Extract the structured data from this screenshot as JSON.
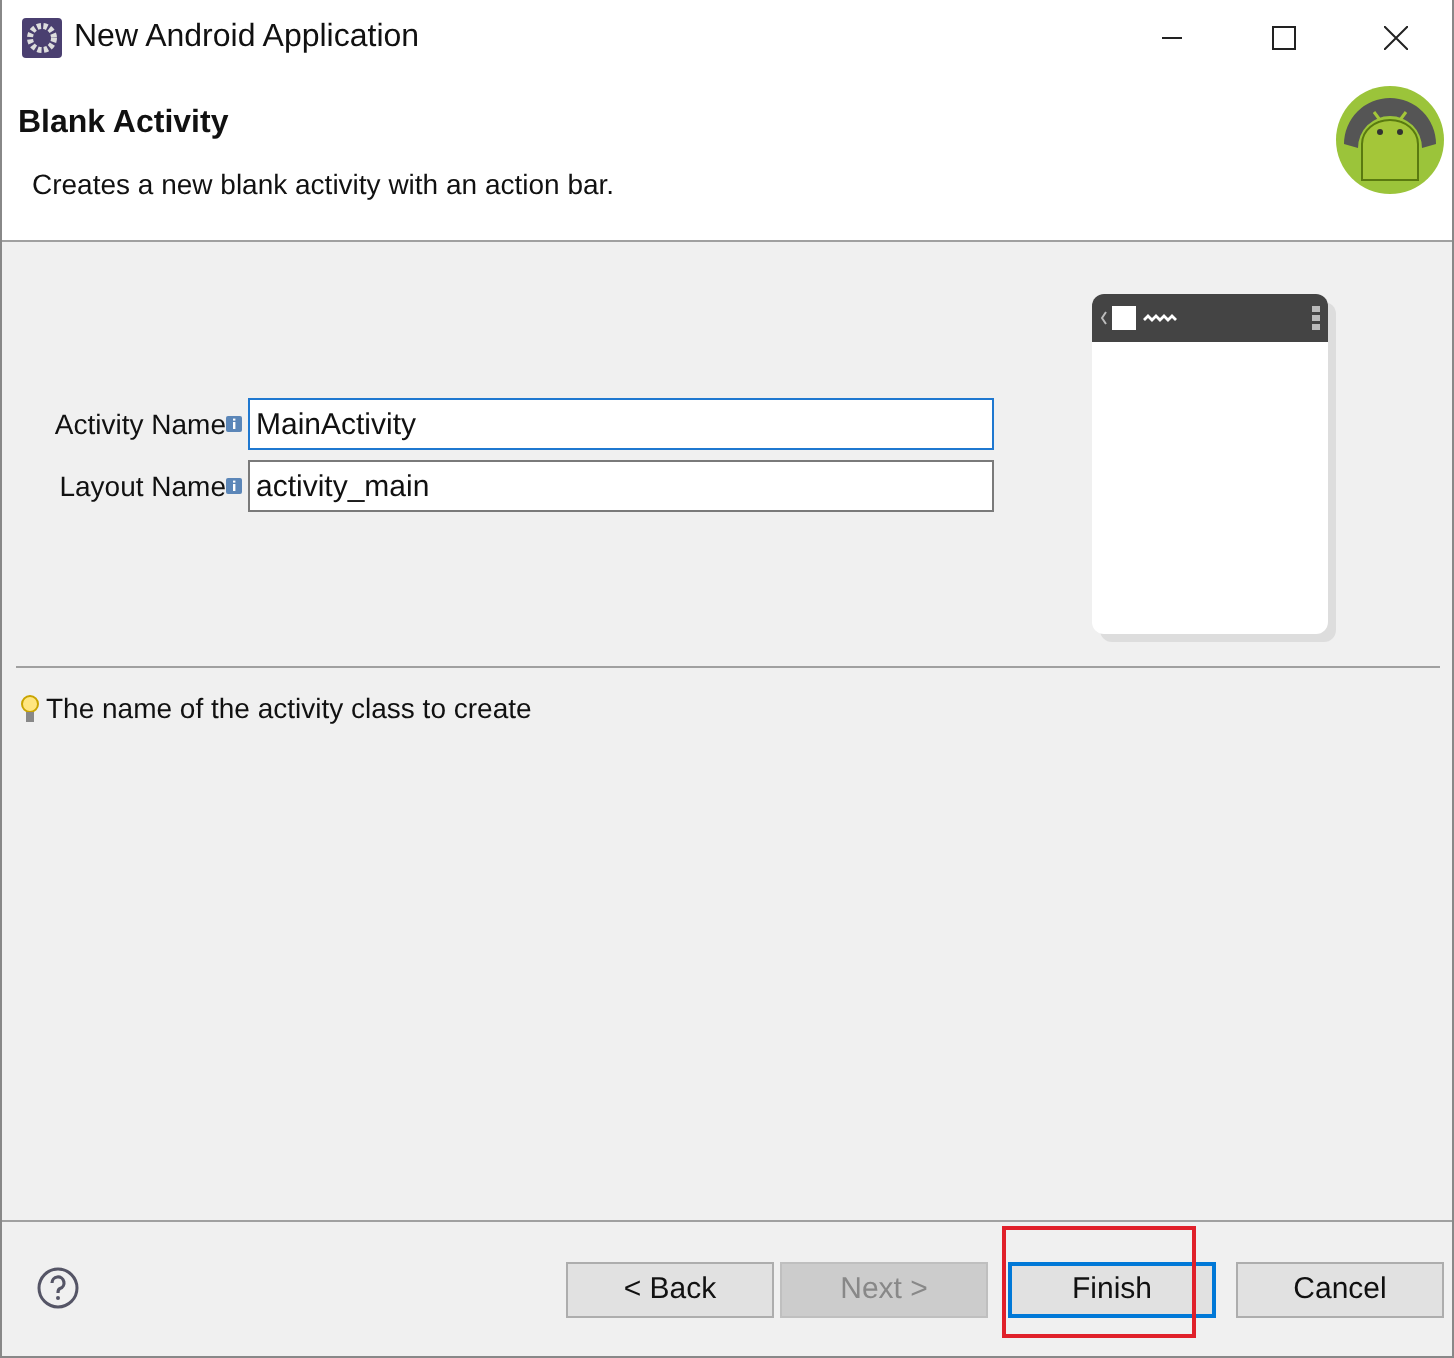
{
  "window": {
    "title": "New Android Application"
  },
  "header": {
    "title": "Blank Activity",
    "description": "Creates a new blank activity with an action bar."
  },
  "fields": [
    {
      "label": "Activity Name",
      "value": "MainActivity",
      "focused": true
    },
    {
      "label": "Layout Name",
      "value": "activity_main",
      "focused": false
    }
  ],
  "hint": "The name of the activity class to create",
  "buttons": [
    {
      "label": "< Back",
      "disabled": false,
      "focused": false
    },
    {
      "label": "Next >",
      "disabled": true,
      "focused": false
    },
    {
      "label": "Finish",
      "disabled": false,
      "focused": true
    },
    {
      "label": "Cancel",
      "disabled": false,
      "focused": false
    }
  ]
}
